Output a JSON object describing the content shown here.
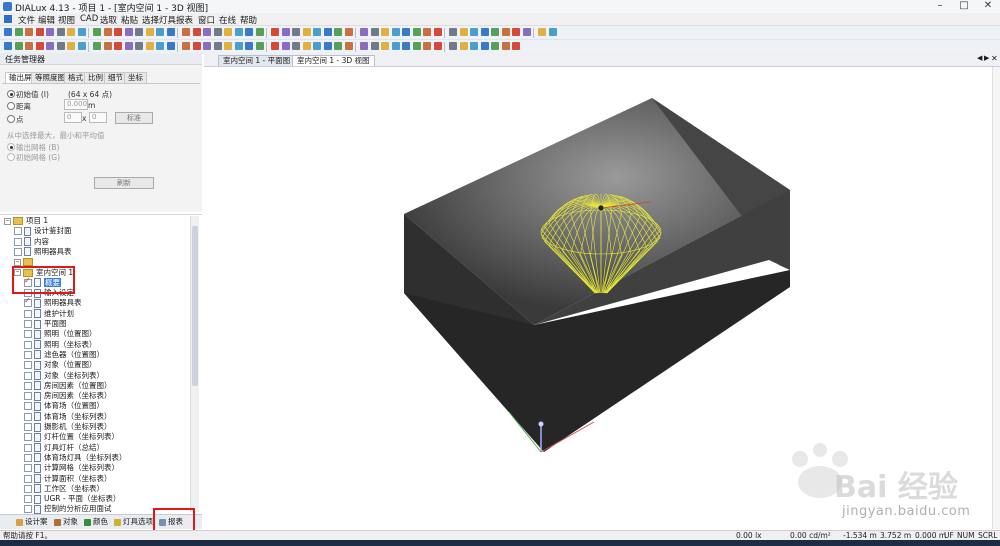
{
  "window": {
    "title": "DIALux 4.13 - 项目 1 - [室内空间 1 - 3D 视图]",
    "controls": [
      "–",
      "□",
      "✕"
    ]
  },
  "menubar": {
    "items": [
      "文件",
      "编辑",
      "视图",
      "CAD",
      "选取",
      "粘贴",
      "选择灯具",
      "报表",
      "窗口",
      "在线",
      "帮助"
    ]
  },
  "task_manager": {
    "title": "任务管理器",
    "tabs": [
      "输出屏",
      "等照度图",
      "格式",
      "比例",
      "细节",
      "坐标"
    ],
    "options": {
      "initial": {
        "label": "初始值 (I)",
        "value": "(64 x 64 点)"
      },
      "distance": {
        "label": "距离",
        "value": "0.000",
        "unit": "m"
      },
      "point": {
        "label": "点",
        "x_value": "0",
        "x_sep": "x",
        "y_value": "0",
        "button": "标准"
      }
    },
    "grid_heading": "从中选择最大，最小和平均值",
    "grid_options": [
      "输出网格 (B)",
      "初始网格 (G)"
    ],
    "refresh_button": "刷新"
  },
  "tree": {
    "items": [
      {
        "label": "项目 1",
        "kind": "folder",
        "level": 0
      },
      {
        "label": "设计鉴封面",
        "kind": "doc",
        "level": 1
      },
      {
        "label": "内容",
        "kind": "doc",
        "level": 1
      },
      {
        "label": "照明器具表",
        "kind": "doc",
        "level": 1
      },
      {
        "label": "",
        "kind": "folder",
        "level": 1
      },
      {
        "label": "室内空间 1",
        "kind": "folder",
        "level": 1
      },
      {
        "label": "概要",
        "kind": "doc",
        "level": 2,
        "selected": true,
        "checked": true
      },
      {
        "label": "输入设定",
        "kind": "doc",
        "level": 2
      },
      {
        "label": "照明器具表",
        "kind": "doc",
        "level": 2,
        "checked": true
      },
      {
        "label": "维护计划",
        "kind": "doc",
        "level": 2
      },
      {
        "label": "平面图",
        "kind": "doc",
        "level": 2
      },
      {
        "label": "照明（位置图）",
        "kind": "doc",
        "level": 2
      },
      {
        "label": "照明（坐标表）",
        "kind": "doc",
        "level": 2
      },
      {
        "label": "滤色器（位置图）",
        "kind": "doc",
        "level": 2
      },
      {
        "label": "对象（位置图）",
        "kind": "doc",
        "level": 2
      },
      {
        "label": "对象（坐标列表）",
        "kind": "doc",
        "level": 2
      },
      {
        "label": "房间因素（位置图）",
        "kind": "doc",
        "level": 2
      },
      {
        "label": "房间因素（坐标表）",
        "kind": "doc",
        "level": 2
      },
      {
        "label": "体育场（位置图）",
        "kind": "doc",
        "level": 2
      },
      {
        "label": "体育场（坐标列表）",
        "kind": "doc",
        "level": 2
      },
      {
        "label": "摄影机（坐标列表）",
        "kind": "doc",
        "level": 2
      },
      {
        "label": "灯杆位置（坐标列表）",
        "kind": "doc",
        "level": 2
      },
      {
        "label": "灯具灯杆（总结）",
        "kind": "doc",
        "level": 2
      },
      {
        "label": "体育场灯具（坐标列表）",
        "kind": "doc",
        "level": 2
      },
      {
        "label": "计算网格（坐标列表）",
        "kind": "doc",
        "level": 2
      },
      {
        "label": "计算面积（坐标表）",
        "kind": "doc",
        "level": 2
      },
      {
        "label": "工作区（坐标表）",
        "kind": "doc",
        "level": 2
      },
      {
        "label": "UGR - 平面（坐标表）",
        "kind": "doc",
        "level": 2
      },
      {
        "label": "控制的分析应用面试",
        "kind": "doc",
        "level": 2
      }
    ]
  },
  "bottom_tabs": [
    "设计案",
    "对象",
    "颜色",
    "灯具选项",
    "报表"
  ],
  "view_tabs": [
    "室内空间 1 - 平面图",
    "室内空间 1 - 3D 视图"
  ],
  "viewport_nav": [
    "◀",
    "▶",
    "✕"
  ],
  "status": {
    "help": "帮助请按 F1。",
    "illuminance": "0.00 lx",
    "luminance": "0.00 cd/m²",
    "x": "-1.534 m",
    "y": "3.752 m",
    "z": "0.000 m",
    "flags": [
      "UF",
      "NUM",
      "SCRL"
    ]
  },
  "watermark": {
    "brand": "Bai 经验",
    "url": "jingyan.baidu.com"
  },
  "colors": {
    "wall": "#363636",
    "floor": "#262626",
    "luminaire_rays": "#e8e838",
    "highlight_box": "#e01818"
  }
}
